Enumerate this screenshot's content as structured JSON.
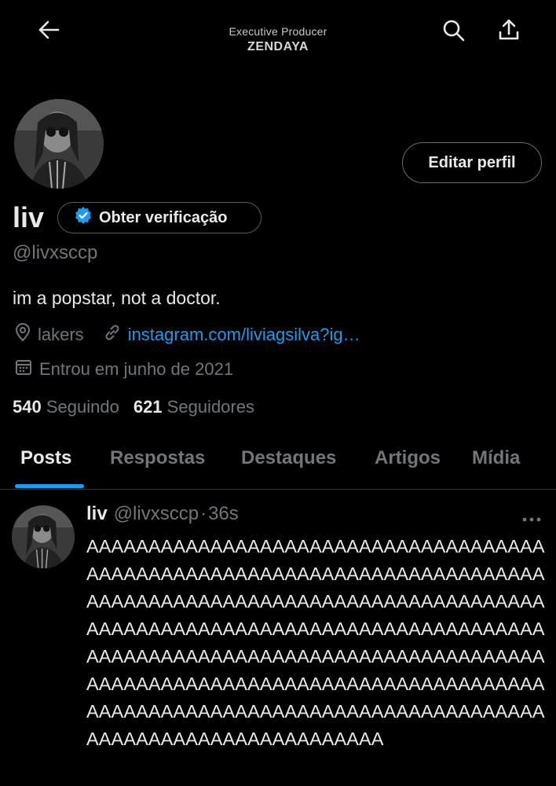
{
  "header": {
    "subtitle": "Executive Producer",
    "title": "ZENDAYA",
    "icons": [
      "back-arrow-icon",
      "search-icon",
      "share-icon"
    ]
  },
  "profile": {
    "edit_button": "Editar perfil",
    "name": "liv",
    "verify_button": "Obter verificação",
    "handle": "@livxsccp",
    "bio": "im a popstar, not a doctor.",
    "location": "lakers",
    "link": "instagram.com/liviagsilva?ig…",
    "joined": "Entrou em junho de 2021",
    "following_count": "540",
    "following_label": "Seguindo",
    "followers_count": "621",
    "followers_label": "Seguidores",
    "accent_color": "#1d9bf0"
  },
  "tabs": [
    {
      "label": "Posts",
      "active": true
    },
    {
      "label": "Respostas",
      "active": false
    },
    {
      "label": "Destaques",
      "active": false
    },
    {
      "label": "Artigos",
      "active": false
    },
    {
      "label": "Mídia",
      "active": false
    }
  ],
  "post": {
    "name": "liv",
    "handle": "@livxsccp",
    "separator": "·",
    "time": "36s",
    "text": "AAAAAAAAAAAAAAAAAAAAAAAAAAAAAAAAAAAAAAAAAAAAAAAAAAAAAAAAAAAAAAAAAAAAAAAAAAAAAAAAAAAAAAAAAAAAAAAAAAAAAAAAAAAAAAAAAAAAAAAAAAAAAAAAAAAAAAAAAAAAAAAAAAAAAAAAAAAAAAAAAAAAAAAAAAAAAAAAAAAAAAAAAAAAAAAAAAAAAAAAAAAAAAAAAAAAAAAAAAAAAAAAAAAAAAAAAAAAAAAAAAAAAAAAAAAAAAAAAAAAAAAAAAAAAAAAAAAAAAAAAAA"
  }
}
